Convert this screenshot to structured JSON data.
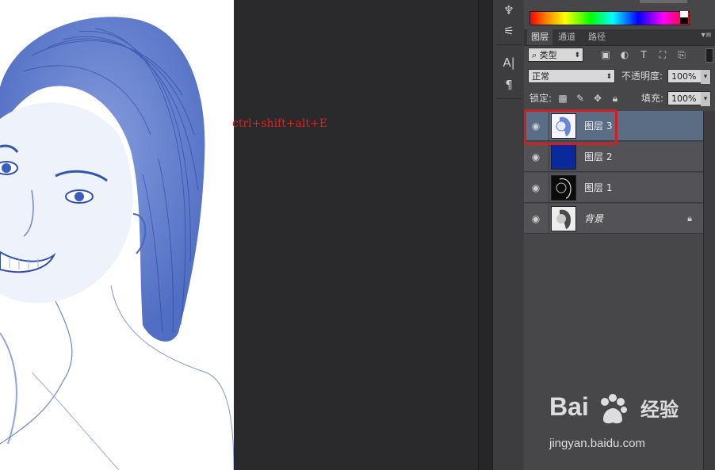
{
  "canvas": {
    "annotation_text": "ctrl+shift+alt+E"
  },
  "dock": {
    "icons": [
      "brush-presets-icon",
      "adjustments-icon",
      "character-icon",
      "paragraph-icon"
    ]
  },
  "layers_panel": {
    "tabs": [
      {
        "label": "图层",
        "active": true
      },
      {
        "label": "通道",
        "active": false
      },
      {
        "label": "路径",
        "active": false
      }
    ],
    "filter": {
      "kind_label": "类型"
    },
    "blend": {
      "mode": "正常",
      "opacity_label": "不透明度:",
      "opacity_value": "100%"
    },
    "lock": {
      "lock_label": "锁定:",
      "fill_label": "填充:",
      "fill_value": "100%"
    },
    "layers": [
      {
        "name": "图层 3",
        "selected": true,
        "thumb": "sketch"
      },
      {
        "name": "图层 2",
        "selected": false,
        "thumb": "blue-fill",
        "color": "#0a2a9c"
      },
      {
        "name": "图层 1",
        "selected": false,
        "thumb": "dark-sketch"
      },
      {
        "name": "背景",
        "selected": false,
        "thumb": "photo",
        "locked": true
      }
    ]
  },
  "watermark": {
    "logo": "Bai",
    "logo_suffix": "经验",
    "url": "jingyan.baidu.com"
  },
  "colors": {
    "highlight": "#cf1f25",
    "annotation": "#e0201f",
    "sketch_blue": "#2a4fb0"
  }
}
